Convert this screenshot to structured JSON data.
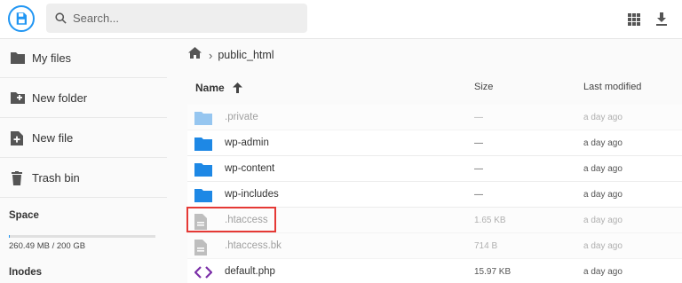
{
  "header": {
    "search_placeholder": "Search...",
    "accent_color": "#2196f3"
  },
  "sidebar": {
    "items": [
      {
        "label": "My files",
        "icon": "folder-icon"
      },
      {
        "label": "New folder",
        "icon": "create-folder-icon"
      },
      {
        "label": "New file",
        "icon": "create-file-icon"
      },
      {
        "label": "Trash bin",
        "icon": "trash-icon"
      }
    ],
    "space_title": "Space",
    "space_usage": "260.49 MB / 200 GB",
    "space_used_fraction": 0.0013,
    "inodes_title": "Inodes"
  },
  "breadcrumb": {
    "path": "public_html"
  },
  "table": {
    "columns": {
      "name": "Name",
      "size": "Size",
      "modified": "Last modified"
    },
    "rows": [
      {
        "name": ".private",
        "size": "—",
        "modified": "a day ago",
        "type": "folder",
        "hidden": true
      },
      {
        "name": "wp-admin",
        "size": "—",
        "modified": "a day ago",
        "type": "folder",
        "hidden": false
      },
      {
        "name": "wp-content",
        "size": "—",
        "modified": "a day ago",
        "type": "folder",
        "hidden": false
      },
      {
        "name": "wp-includes",
        "size": "—",
        "modified": "a day ago",
        "type": "folder",
        "hidden": false
      },
      {
        "name": ".htaccess",
        "size": "1.65 KB",
        "modified": "a day ago",
        "type": "file",
        "hidden": true
      },
      {
        "name": ".htaccess.bk",
        "size": "714 B",
        "modified": "a day ago",
        "type": "file",
        "hidden": true
      },
      {
        "name": "default.php",
        "size": "15.97 KB",
        "modified": "a day ago",
        "type": "code",
        "hidden": false
      }
    ]
  },
  "colors": {
    "folder": "#1e88e5",
    "code": "#7b2fa8",
    "highlight_border": "#e53935"
  }
}
